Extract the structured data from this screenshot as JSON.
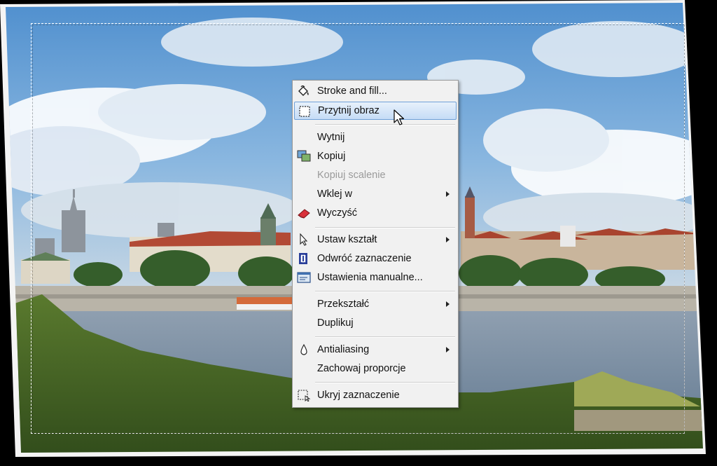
{
  "context_menu": {
    "items": [
      {
        "label": "Stroke and fill...",
        "icon": "paint-bucket-icon"
      },
      {
        "label": "Przytnij obraz",
        "icon": "crop-selection-icon",
        "highlighted": true
      },
      {
        "label": "Wytnij"
      },
      {
        "label": "Kopiuj",
        "icon": "copy-image-icon"
      },
      {
        "label": "Kopiuj scalenie",
        "disabled": true
      },
      {
        "label": "Wklej w",
        "submenu": true
      },
      {
        "label": "Wyczyść",
        "icon": "eraser-icon"
      },
      {
        "label": "Ustaw kształt",
        "icon": "pointer-icon",
        "submenu": true
      },
      {
        "label": "Odwróć zaznaczenie",
        "icon": "invert-selection-icon"
      },
      {
        "label": "Ustawienia manualne...",
        "icon": "manual-settings-icon"
      },
      {
        "label": "Przekształć",
        "submenu": true
      },
      {
        "label": "Duplikuj"
      },
      {
        "label": "Antialiasing",
        "icon": "droplet-icon",
        "submenu": true
      },
      {
        "label": "Zachowaj proporcje"
      },
      {
        "label": "Ukryj zaznaczenie",
        "icon": "hide-selection-icon"
      }
    ]
  },
  "colors": {
    "menu_bg": "#f1f1f1",
    "highlight": "#c5dcf6",
    "sky": "#6aa3d8"
  }
}
